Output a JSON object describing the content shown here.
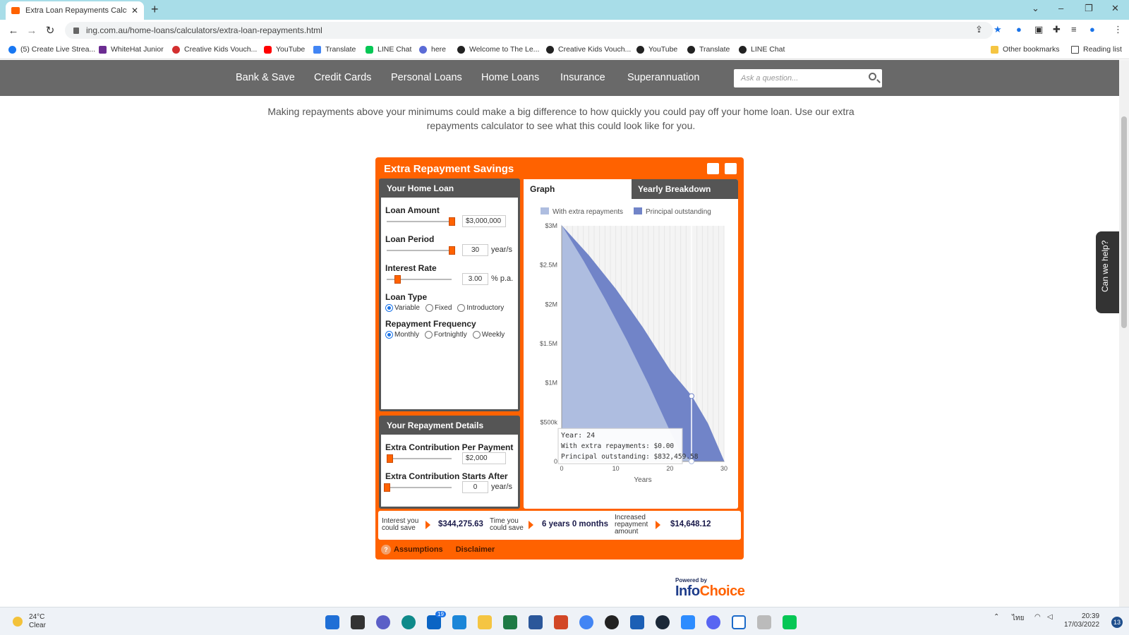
{
  "browser": {
    "tab_title": "Extra Loan Repayments Calculato",
    "url": "ing.com.au/home-loans/calculators/extra-loan-repayments.html",
    "bookmarks": [
      "(5) Create Live Strea...",
      "WhiteHat Junior",
      "Creative Kids Vouch...",
      "YouTube",
      "Translate",
      "LINE Chat",
      "here",
      "Welcome to The Le...",
      "Creative Kids Vouch...",
      "YouTube",
      "Translate",
      "LINE Chat"
    ],
    "other_bookmarks": "Other bookmarks",
    "reading_list": "Reading list"
  },
  "site_nav": {
    "items": [
      "Bank & Save",
      "Credit Cards",
      "Personal Loans",
      "Home Loans",
      "Insurance",
      "Superannuation"
    ],
    "search_placeholder": "Ask a question..."
  },
  "page": {
    "intro": "Making repayments above your minimums could make a big difference to how quickly you could pay off your home loan. Use our extra repayments calculator to see what this could look like for you.",
    "help_tab": "Can we help?"
  },
  "calculator": {
    "title": "Extra Repayment Savings",
    "home_loan_header": "Your Home Loan",
    "loan_amount_label": "Loan Amount",
    "loan_amount_value": "$3,000,000",
    "loan_period_label": "Loan Period",
    "loan_period_value": "30",
    "years_unit": "year/s",
    "interest_rate_label": "Interest Rate",
    "interest_rate_value": "3.00",
    "interest_unit": "% p.a.",
    "loan_type_label": "Loan Type",
    "loan_type_options": [
      "Variable",
      "Fixed",
      "Introductory"
    ],
    "repayment_freq_label": "Repayment Frequency",
    "repayment_freq_options": [
      "Monthly",
      "Fortnightly",
      "Weekly"
    ],
    "repayment_details_header": "Your Repayment Details",
    "extra_contribution_label": "Extra Contribution Per Payment",
    "extra_contribution_value": "$2,000",
    "starts_after_label": "Extra Contribution Starts After",
    "starts_after_value": "0",
    "tab_graph": "Graph",
    "tab_breakdown": "Yearly Breakdown",
    "results": {
      "interest_label_1": "Interest you",
      "interest_label_2": "could save",
      "interest_value": "$344,275.63",
      "time_label_1": "Time you",
      "time_label_2": "could save",
      "time_value": "6 years 0 months",
      "increase_label_1": "Increased",
      "increase_label_2": "repayment",
      "increase_label_3": "amount",
      "increase_value": "$14,648.12"
    },
    "assumptions": "Assumptions",
    "disclaimer": "Disclaimer",
    "powered_by": "Powered by",
    "infochoice_info": "Info",
    "infochoice_choice": "Choice"
  },
  "chart_data": {
    "type": "area",
    "xlabel": "Years",
    "ylabel": "",
    "xlim": [
      0,
      30
    ],
    "ylim": [
      0,
      3000000
    ],
    "x_ticks": [
      "0",
      "10",
      "20",
      "30"
    ],
    "y_ticks": [
      "0",
      "$500k",
      "$1M",
      "$1.5M",
      "$2M",
      "$2.5M",
      "$3M"
    ],
    "legend": [
      "With extra repayments",
      "Principal outstanding"
    ],
    "series": [
      {
        "name": "With extra repayments",
        "color": "#aebde0",
        "x": [
          0,
          4,
          8,
          12,
          16,
          20,
          22,
          24
        ],
        "y": [
          3000000,
          2550000,
          2060000,
          1540000,
          980000,
          380000,
          110000,
          0
        ]
      },
      {
        "name": "Principal outstanding",
        "color": "#7184c8",
        "x": [
          0,
          5,
          10,
          15,
          20,
          24,
          27,
          30
        ],
        "y": [
          3000000,
          2620000,
          2190000,
          1700000,
          1160000,
          832459.58,
          480000,
          0
        ]
      }
    ],
    "tooltip": {
      "line1": "Year: 24",
      "line2": "With extra repayments: $0.00",
      "line3": "Principal outstanding: $832,459.58"
    }
  },
  "taskbar": {
    "temp": "24°C",
    "condition": "Clear",
    "time": "20:39",
    "date": "17/03/2022",
    "mail_badge": "19",
    "notifications": "13"
  }
}
